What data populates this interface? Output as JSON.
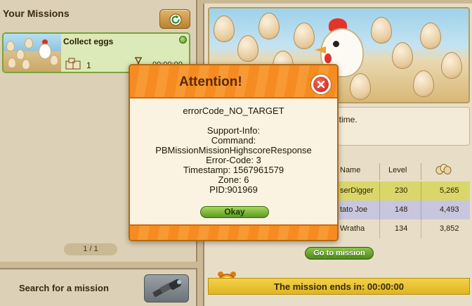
{
  "left_panel": {
    "title": "Your Missions",
    "refresh_icon": "refresh-icon",
    "mission": {
      "name": "Collect eggs",
      "count": "1",
      "time": "00:00:00",
      "status_color": "#5a9a22"
    },
    "pager": "1 / 1",
    "search_label": "Search for a mission",
    "search_icon": "spyglass-icon"
  },
  "right_panel": {
    "description": "ven time.",
    "highscore": {
      "columns": [
        "Name",
        "Level",
        "eggs-icon"
      ],
      "rows": [
        {
          "name": "serDigger",
          "level": "230",
          "eggs": "5,265",
          "color": "#d9d76a"
        },
        {
          "name": "tato Joe",
          "level": "148",
          "eggs": "4,493",
          "color": "#c7c6de"
        },
        {
          "name": "Wratha",
          "level": "134",
          "eggs": "3,852",
          "color": "#e8dec7"
        }
      ]
    },
    "go_button": "Go to mission",
    "end_text": "The mission ends in: 00:00:00"
  },
  "dialog": {
    "title": "Attention!",
    "error_code": "errorCode_NO_TARGET",
    "support_info": "Support-Info:",
    "command_label": "Command:",
    "command": "PBMissionMissionHighscoreResponse",
    "error_code_line": "Error-Code: 3",
    "timestamp": "Timestamp: 1567961579",
    "zone": "Zone: 6",
    "pid": "PID:901969",
    "okay_button": "Okay",
    "close_icon": "close-icon"
  },
  "colors": {
    "accent_orange": "#f68b22",
    "okay_green": "#5b9a22",
    "end_bar_yellow": "#dfb521"
  }
}
